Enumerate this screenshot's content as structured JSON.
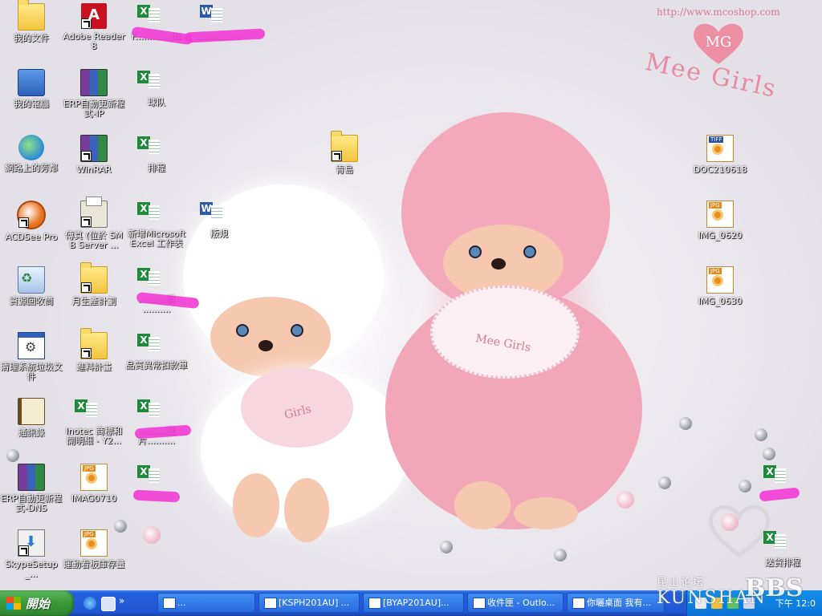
{
  "wallpaper": {
    "url_text": "http://www.mcoshop.com",
    "logo_text": "MG",
    "brand_text": "Mee Girls",
    "bib_text_pink": "Mee Girls",
    "bib_text_white": "Girls"
  },
  "desktop_icons": [
    {
      "key": "my-documents",
      "label": "我的文件",
      "glyph": "folder"
    },
    {
      "key": "adobe-reader",
      "label": "Adobe Reader 8",
      "glyph": "pdf"
    },
    {
      "key": "excel-redacted-1",
      "label": "F.............ds",
      "glyph": "xls"
    },
    {
      "key": "word-redacted-1",
      "label": "................",
      "glyph": "word"
    },
    {
      "key": "my-computer",
      "label": "我的電腦",
      "glyph": "pc"
    },
    {
      "key": "erp-update-ip",
      "label": "ERP自動更新程式-IP",
      "glyph": "rar"
    },
    {
      "key": "team",
      "label": "球队",
      "glyph": "xls"
    },
    {
      "key": "network-places",
      "label": "網路上的芳鄰",
      "glyph": "net"
    },
    {
      "key": "winrar",
      "label": "WinRAR",
      "glyph": "rar"
    },
    {
      "key": "schedule",
      "label": "排程",
      "glyph": "xls"
    },
    {
      "key": "qingdao",
      "label": "青島",
      "glyph": "folder"
    },
    {
      "key": "doc210618",
      "label": "DOC210618",
      "glyph": "tiff"
    },
    {
      "key": "acdsee",
      "label": "ACDSee Pro",
      "glyph": "acdsee"
    },
    {
      "key": "fax",
      "label": "傳真 (位於 SMB Server ...",
      "glyph": "fax"
    },
    {
      "key": "new-excel",
      "label": "新增Microsoft Excel 工作表",
      "glyph": "xls"
    },
    {
      "key": "layout",
      "label": "版規",
      "glyph": "word"
    },
    {
      "key": "img-0620",
      "label": "IMG_0620",
      "glyph": "img"
    },
    {
      "key": "recycle-bin",
      "label": "資源回收筒",
      "glyph": "recycle"
    },
    {
      "key": "monthly-plan",
      "label": "月生產計劃",
      "glyph": "folder"
    },
    {
      "key": "excel-redacted-2",
      "label": "..........明 ..........",
      "glyph": "xls"
    },
    {
      "key": "img-0630",
      "label": "IMG_0630",
      "glyph": "img"
    },
    {
      "key": "cleanup-junk",
      "label": "清理系統垃圾文件",
      "glyph": "window"
    },
    {
      "key": "material-plan",
      "label": "進料計畫",
      "glyph": "folder"
    },
    {
      "key": "quality-deduction",
      "label": "品質異常扣款單",
      "glyph": "xls"
    },
    {
      "key": "contacts",
      "label": "通訊錄",
      "glyph": "book"
    },
    {
      "key": "inotec",
      "label": "Inotec 商標和開明細 - Y2...",
      "glyph": "xls"
    },
    {
      "key": "excel-redacted-3",
      "label": "..........量 片..........",
      "glyph": "xls"
    },
    {
      "key": "erp-update-dns",
      "label": "ERP自動更新程式-DNS",
      "glyph": "rar"
    },
    {
      "key": "imag0710",
      "label": "IMAG0710",
      "glyph": "img"
    },
    {
      "key": "excel-redacted-4",
      "label": "",
      "glyph": "xls"
    },
    {
      "key": "excel-redacted-5",
      "label": "",
      "glyph": "xls"
    },
    {
      "key": "skype-setup",
      "label": "SkypeSetup_...",
      "glyph": "setup"
    },
    {
      "key": "kanban-stock",
      "label": "運動看板庫存量",
      "glyph": "img"
    },
    {
      "key": "delivery-schedule",
      "label": "送貨排程",
      "glyph": "xls"
    }
  ],
  "taskbar": {
    "start_label": "開始",
    "quicklaunch_more": "»",
    "buttons": [
      {
        "label": "..."
      },
      {
        "label": "[KSPH201AU] ..."
      },
      {
        "label": "[BYAP201AU]..."
      },
      {
        "label": "收件匣 - Outlo..."
      },
      {
        "label": "你曬桌面 我有..."
      }
    ],
    "clock": "下午 12:0"
  },
  "watermark": {
    "site_cn": "昆山论坛",
    "site_en": "KUNSHAN",
    "bbs": "BBS"
  },
  "colors": {
    "taskbar_blue": "#245edb",
    "start_green": "#3a9a3a",
    "tray_blue": "#0b72d8",
    "redaction_magenta": "#f23bd5",
    "brand_pink": "#e88aa0"
  }
}
